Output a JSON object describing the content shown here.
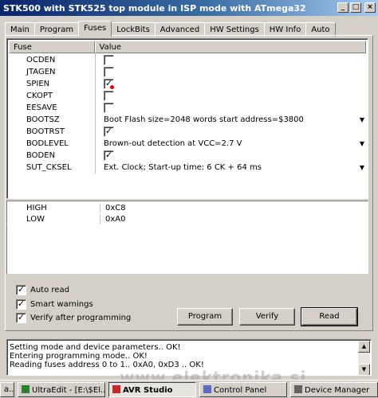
{
  "window": {
    "title": "STK500 with STK525 top module in ISP mode with ATmega32",
    "minimize": "_",
    "maximize": "□",
    "close": "×"
  },
  "tabs": [
    "Main",
    "Program",
    "Fuses",
    "LockBits",
    "Advanced",
    "HW Settings",
    "HW Info",
    "Auto"
  ],
  "active_tab": "Fuses",
  "fuse_table": {
    "col_fuse": "Fuse",
    "col_value": "Value",
    "rows": [
      {
        "name": "OCDEN",
        "type": "check",
        "checked": false
      },
      {
        "name": "JTAGEN",
        "type": "check",
        "checked": false
      },
      {
        "name": "SPIEN",
        "type": "check",
        "checked": true
      },
      {
        "name": "CKOPT",
        "type": "check",
        "checked": false
      },
      {
        "name": "EESAVE",
        "type": "check",
        "checked": false
      },
      {
        "name": "BOOTSZ",
        "type": "select",
        "value": "Boot Flash size=2048 words start address=$3800"
      },
      {
        "name": "BOOTRST",
        "type": "check",
        "checked": true
      },
      {
        "name": "BODLEVEL",
        "type": "select",
        "value": "Brown-out detection at VCC=2.7 V"
      },
      {
        "name": "BODEN",
        "type": "check",
        "checked": true
      },
      {
        "name": "SUT_CKSEL",
        "type": "select",
        "value": "Ext. Clock; Start-up time: 6 CK + 64 ms"
      }
    ]
  },
  "hex_values": [
    {
      "name": "HIGH",
      "value": "0xC8"
    },
    {
      "name": "LOW",
      "value": "0xA0"
    }
  ],
  "options": [
    {
      "label": "Auto read",
      "checked": true
    },
    {
      "label": "Smart warnings",
      "checked": true
    },
    {
      "label": "Verify after programming",
      "checked": true
    }
  ],
  "buttons": {
    "program": "Program",
    "verify": "Verify",
    "read": "Read"
  },
  "log": [
    "Setting mode and device parameters.. OK!",
    "Entering programming mode.. OK!",
    "Reading fuses address 0 to 1.. 0xA0, 0xD3 .. OK!"
  ],
  "taskbar": [
    {
      "label": "a...",
      "active": false
    },
    {
      "label": "UltraEdit - [E:\\$El...",
      "active": false
    },
    {
      "label": "AVR Studio",
      "active": true
    },
    {
      "label": "Control Panel",
      "active": false
    },
    {
      "label": "Device Manager",
      "active": false
    }
  ],
  "watermark": "www.elektronika.si"
}
